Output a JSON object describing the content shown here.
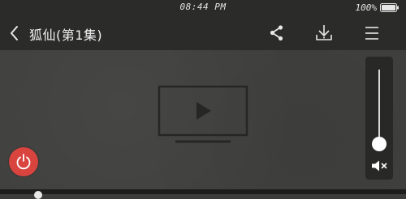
{
  "status_bar": {
    "time": "08:44 PM",
    "battery_percent_label": "100%",
    "battery_level": 1.0
  },
  "header": {
    "title": "狐仙(第1集)",
    "back_icon": "chevron-left-icon",
    "share_icon": "share-icon",
    "download_icon": "download-icon",
    "menu_icon": "menu-icon"
  },
  "player": {
    "placeholder_icon": "tv-play-icon",
    "power_icon": "power-icon",
    "power_color": "#d9443f",
    "volume_level": 0.0,
    "mute_icon": "speaker-mute-icon"
  }
}
